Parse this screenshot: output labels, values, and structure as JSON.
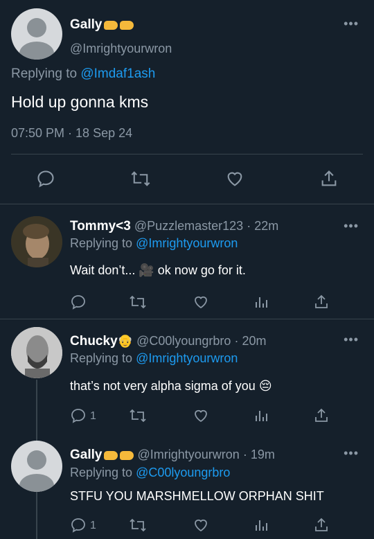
{
  "main_tweet": {
    "name": "Gally",
    "handle": "@Imrightyourwron",
    "replying_prefix": "Replying to",
    "replying_to": "@Imdaf1ash",
    "text": "Hold up gonna kms",
    "timestamp": "07:50 PM · 18 Sep 24",
    "emoji_name": "fist-bump-emojis",
    "actions": [
      "reply-icon",
      "retweet-icon",
      "like-icon",
      "share-icon"
    ]
  },
  "replies": [
    {
      "name": "Tommy<3",
      "handle": "@Puzzlemaster123",
      "time": "· 22m",
      "replying_prefix": "Replying to",
      "replying_to": "@Imrightyourwron",
      "text": "Wait don’t... 🎥 ok now go for it.",
      "reply_count": ""
    },
    {
      "name": "Chucky",
      "name_emoji": "👴",
      "handle": "@C00lyoungrbro",
      "time": "· 20m",
      "replying_prefix": "Replying to",
      "replying_to": "@Imrightyourwron",
      "text": "that’s not very alpha sigma of you 😔",
      "reply_count": "1"
    },
    {
      "name": "Gally",
      "handle": "@Imrightyourwron",
      "time": "· 19m",
      "replying_prefix": "Replying to",
      "replying_to": "@C00lyoungrbro",
      "text": "STFU YOU MARSHMELLOW ORPHAN SHIT",
      "reply_count": "1"
    }
  ],
  "colors": {
    "background": "#15202b",
    "link": "#1d9bf0",
    "muted": "#8b98a5",
    "divider": "#38444d"
  }
}
